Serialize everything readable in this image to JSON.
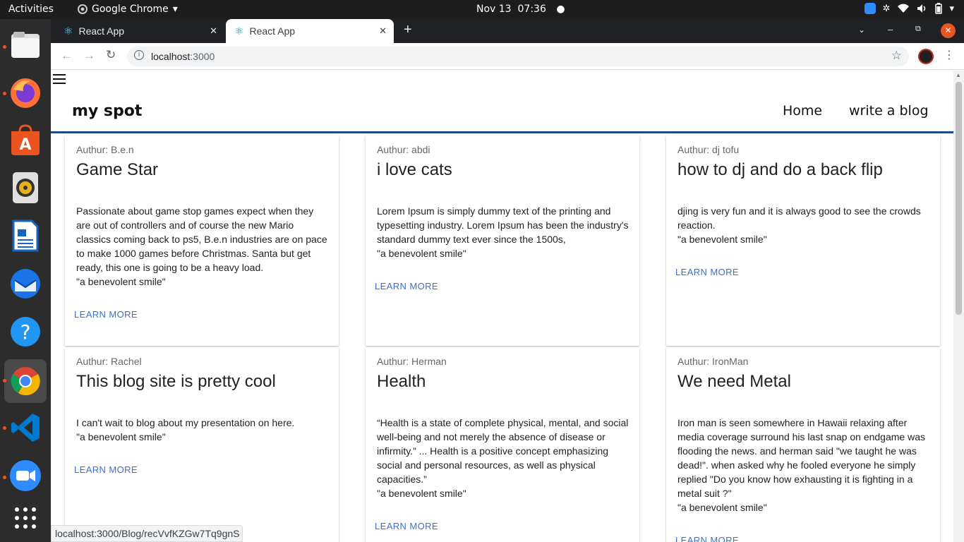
{
  "topbar": {
    "activities": "Activities",
    "app_name": "Google Chrome",
    "date": "Nov 13",
    "time": "07:36"
  },
  "browser": {
    "tabs": [
      {
        "title": "React App",
        "active": false
      },
      {
        "title": "React App",
        "active": true
      }
    ],
    "url_host": "localhost",
    "url_port": ":3000",
    "status_url": "localhost:3000/Blog/recVvfKZGw7Tq9gnS"
  },
  "site": {
    "brand": "my spot",
    "nav": [
      "Home",
      "write a blog"
    ],
    "learn_more": "LEARN MORE",
    "cards": [
      {
        "author": "Authur: B.e.n",
        "title": "Game Star",
        "body": "Passionate about game stop games expect when they are out of controllers and of course the new Mario classics coming back to ps5, B.e.n industries are on pace to make 1000 games before Christmas. Santa but get ready, this one is going to be a heavy load.\n\"a benevolent smile\""
      },
      {
        "author": "Authur: abdi",
        "title": "i love cats",
        "body": "Lorem Ipsum is simply dummy text of the printing and typesetting industry. Lorem Ipsum has been the industry's standard dummy text ever since the 1500s,\n\"a benevolent smile\""
      },
      {
        "author": "Authur: dj tofu",
        "title": "how to dj and do a back flip",
        "body": "djing is very fun and it is always good to see the crowds reaction.\n\"a benevolent smile\""
      },
      {
        "author": "Authur: Rachel",
        "title": "This blog site is pretty cool",
        "body": "I can't wait to blog about my presentation on here.\n\"a benevolent smile\""
      },
      {
        "author": "Authur: Herman",
        "title": "Health",
        "body": "“Health is a state of complete physical, mental, and social well-being and not merely the absence of disease or infirmity.” ... Health is a positive concept emphasizing social and personal resources, as well as physical capacities.”\n\"a benevolent smile\""
      },
      {
        "author": "Authur: IronMan",
        "title": "We need Metal",
        "body": "Iron man is seen somewhere in Hawaii relaxing after media coverage surround his last snap on endgame was flooding the news. and herman said \"we taught he was dead!\". when asked why he fooled everyone he simply replied \"Do you know how exhausting it is fighting in a metal suit ?\"\n\"a benevolent smile\""
      }
    ]
  }
}
